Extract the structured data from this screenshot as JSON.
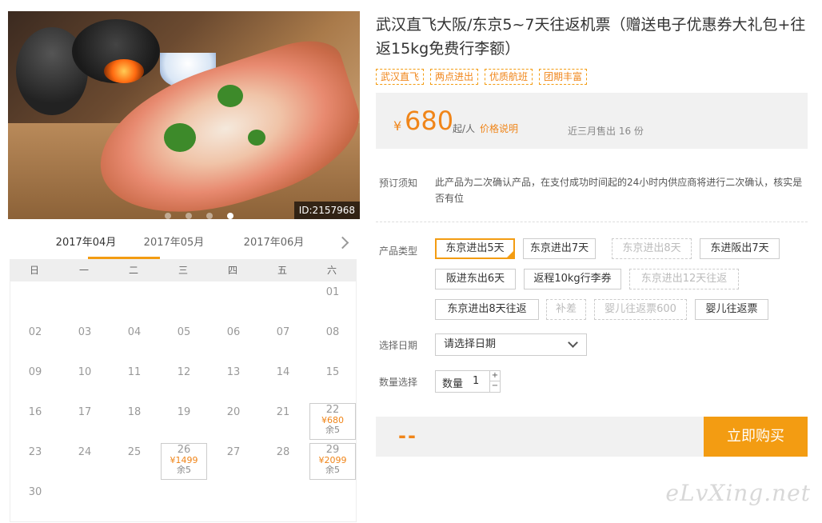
{
  "hero": {
    "image_id": "ID:2157968",
    "slides": 4,
    "active_slide": 4
  },
  "calendar": {
    "months": [
      "2017年04月",
      "2017年05月",
      "2017年06月"
    ],
    "active_month": 0,
    "weekdays": [
      "日",
      "一",
      "二",
      "三",
      "四",
      "五",
      "六"
    ],
    "days": [
      {
        "d": "",
        "w": 0
      },
      {
        "d": "",
        "w": 1
      },
      {
        "d": "",
        "w": 2
      },
      {
        "d": "",
        "w": 3
      },
      {
        "d": "",
        "w": 4
      },
      {
        "d": "",
        "w": 5
      },
      {
        "d": "01"
      },
      {
        "d": "02"
      },
      {
        "d": "03"
      },
      {
        "d": "04"
      },
      {
        "d": "05"
      },
      {
        "d": "06"
      },
      {
        "d": "07"
      },
      {
        "d": "08"
      },
      {
        "d": "09"
      },
      {
        "d": "10"
      },
      {
        "d": "11"
      },
      {
        "d": "12"
      },
      {
        "d": "13"
      },
      {
        "d": "14"
      },
      {
        "d": "15"
      },
      {
        "d": "16"
      },
      {
        "d": "17"
      },
      {
        "d": "18"
      },
      {
        "d": "19"
      },
      {
        "d": "20"
      },
      {
        "d": "21"
      },
      {
        "d": "22",
        "price": "¥680",
        "remain": "余5"
      },
      {
        "d": "23"
      },
      {
        "d": "24"
      },
      {
        "d": "25"
      },
      {
        "d": "26",
        "price": "¥1499",
        "remain": "余5"
      },
      {
        "d": "27"
      },
      {
        "d": "28"
      },
      {
        "d": "29",
        "price": "¥2099",
        "remain": "余5"
      },
      {
        "d": "30"
      }
    ]
  },
  "product": {
    "title": "武汉直飞大阪/东京5~7天往返机票（赠送电子优惠券大礼包+往返15kg免费行李额）",
    "tags": [
      "武汉直飞",
      "两点进出",
      "优质航班",
      "团期丰富"
    ]
  },
  "price": {
    "currency": "¥",
    "amount": "680",
    "from_label": "起/人",
    "explain_label": "价格说明",
    "sold_label": "近三月售出 16 份"
  },
  "notice": {
    "label": "预订须知",
    "text": "此产品为二次确认产品，在支付成功时间起的24小时内供应商将进行二次确认，核实是否有位"
  },
  "options": {
    "label": "产品类型",
    "items": [
      {
        "label": "东京进出5天",
        "state": "selected"
      },
      {
        "label": "东京进出7天",
        "state": "normal"
      },
      {
        "label": "东京进出8天",
        "state": "disabled"
      },
      {
        "label": "东进阪出7天",
        "state": "normal"
      },
      {
        "label": "阪进东出6天",
        "state": "normal"
      },
      {
        "label": "返程10kg行李券",
        "state": "normal"
      },
      {
        "label": "东京进出12天往返",
        "state": "disabled"
      },
      {
        "label": "东京进出8天往返",
        "state": "normal"
      },
      {
        "label": "补差",
        "state": "disabled"
      },
      {
        "label": "婴儿往返票600",
        "state": "disabled"
      },
      {
        "label": "婴儿往返票",
        "state": "normal"
      }
    ]
  },
  "date_select": {
    "label": "选择日期",
    "value": "请选择日期"
  },
  "quantity": {
    "label": "数量选择",
    "field_label": "数量",
    "value": "1",
    "plus": "+",
    "minus": "−"
  },
  "buy": {
    "total": "--",
    "button_label": "立即购买"
  },
  "watermark": "eLvXing.net",
  "colors": {
    "accent": "#f39c12",
    "price": "#f08519"
  }
}
